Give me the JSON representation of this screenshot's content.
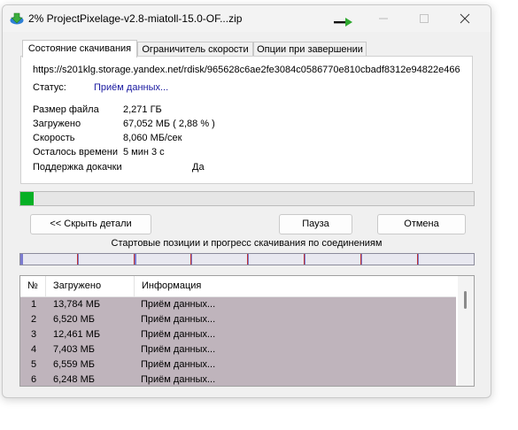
{
  "window": {
    "title": "2% ProjectPixelage-v2.8-miatoll-15.0-OF...zip"
  },
  "tabs": [
    {
      "label": "Состояние скачивания"
    },
    {
      "label": "Ограничитель скорости"
    },
    {
      "label": "Опции при завершении"
    }
  ],
  "status_panel": {
    "url": "https://s201klg.storage.yandex.net/rdisk/965628c6ae2fe3084c0586770e810cbadf8312e94822e466",
    "status_label": "Статус:",
    "status_value": "Приём данных...",
    "file_size_label": "Размер файла",
    "file_size_value": "2,271  ГБ",
    "downloaded_label": "Загружено",
    "downloaded_value": "67,052  МБ  ( 2,88 % )",
    "speed_label": "Скорость",
    "speed_value": "8,060  МБ/сек",
    "time_left_label": "Осталось времени",
    "time_left_value": "5 мин 3 с",
    "resume_label": "Поддержка докачки",
    "resume_value": "Да"
  },
  "progress": {
    "percent": 2.88,
    "fill_color": "#06b025"
  },
  "buttons": {
    "hide_details": "<< Скрыть детали",
    "pause": "Пауза",
    "cancel": "Отмена"
  },
  "connections": {
    "caption": "Стартовые позиции и прогресс скачивания по соединениям",
    "segment_starts": [
      0,
      0.125,
      0.25,
      0.375,
      0.5,
      0.625,
      0.75,
      0.875
    ],
    "segment_progress": [
      0.006,
      0.003,
      0.005,
      0.003,
      0.003,
      0.003,
      0.003,
      0.003
    ],
    "bar_color": "#7b7bd0",
    "tick_color": "#c03030"
  },
  "table": {
    "columns": [
      "№",
      "Загружено",
      "Информация"
    ],
    "rows": [
      {
        "n": "1",
        "downloaded": "13,784  МБ",
        "info": "Приём данных..."
      },
      {
        "n": "2",
        "downloaded": "6,520  МБ",
        "info": "Приём данных..."
      },
      {
        "n": "3",
        "downloaded": "12,461  МБ",
        "info": "Приём данных..."
      },
      {
        "n": "4",
        "downloaded": "7,403  МБ",
        "info": "Приём данных..."
      },
      {
        "n": "5",
        "downloaded": "6,559  МБ",
        "info": "Приём данных..."
      },
      {
        "n": "6",
        "downloaded": "6,248  МБ",
        "info": "Приём данных..."
      }
    ]
  },
  "colors": {
    "status_value": "#1a1aa0",
    "row_highlight": "#bfb4bc"
  },
  "icons": {
    "app": "idm-download-icon",
    "speed": "green-arrow-icon",
    "minimize": "minimize-icon",
    "maximize": "maximize-icon",
    "close": "close-icon"
  }
}
